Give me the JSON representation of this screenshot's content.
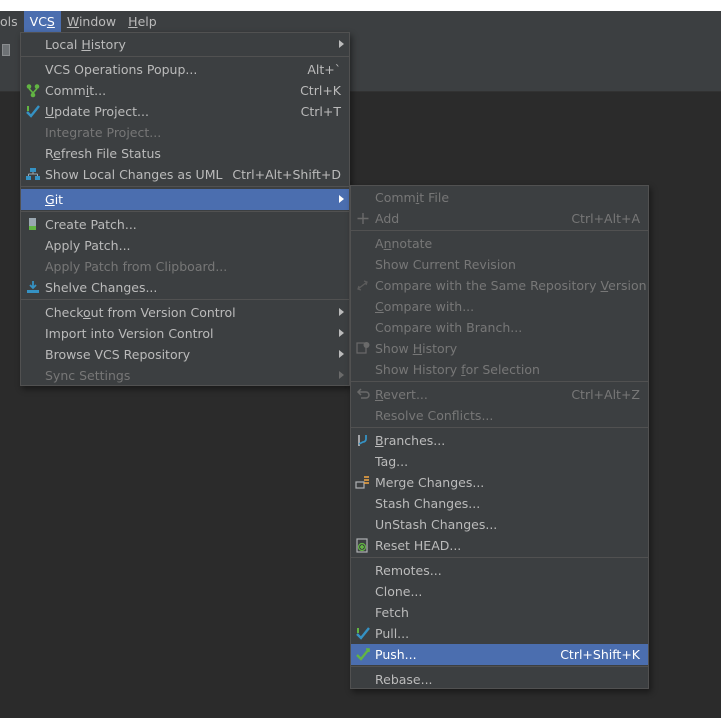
{
  "menubar": {
    "items": [
      {
        "label": "ols",
        "mnemonic": "",
        "after": ""
      },
      {
        "label": "VC",
        "mnemonic": "S",
        "after": ""
      },
      {
        "label": "",
        "mnemonic": "W",
        "after": "indow"
      },
      {
        "label": "",
        "mnemonic": "H",
        "after": "elp"
      }
    ]
  },
  "vcs_menu": {
    "local_history": {
      "pre": "Local ",
      "ac": "H",
      "post": "istory"
    },
    "operations_popup": {
      "label": "VCS Operations Popup...",
      "shortcut": "Alt+`"
    },
    "commit": {
      "pre": "Comm",
      "ac": "i",
      "post": "t...",
      "shortcut": "Ctrl+K"
    },
    "update_project": {
      "pre": "",
      "ac": "U",
      "post": "pdate Project...",
      "shortcut": "Ctrl+T"
    },
    "integrate_project": {
      "label": "Integrate Project..."
    },
    "refresh_status": {
      "pre": "R",
      "ac": "e",
      "post": "fresh File Status"
    },
    "show_local_changes": {
      "label": "Show Local Changes as UML",
      "shortcut": "Ctrl+Alt+Shift+D"
    },
    "git": {
      "pre": "",
      "ac": "G",
      "post": "it"
    },
    "create_patch": {
      "label": "Create Patch..."
    },
    "apply_patch": {
      "label": "Apply Patch..."
    },
    "apply_clipboard": {
      "label": "Apply Patch from Clipboard..."
    },
    "shelve_changes": {
      "label": "Shelve Changes..."
    },
    "checkout": {
      "pre": "Check",
      "ac": "o",
      "post": "ut from Version Control"
    },
    "import": {
      "label": "Import into Version Control"
    },
    "browse": {
      "label": "Browse VCS Repository"
    },
    "sync": {
      "label": "Sync Settings"
    }
  },
  "git_menu": {
    "commit_file": {
      "pre": "Comm",
      "ac": "i",
      "post": "t File"
    },
    "add": {
      "label": "Add",
      "shortcut": "Ctrl+Alt+A"
    },
    "annotate": {
      "pre": "A",
      "ac": "n",
      "post": "notate"
    },
    "show_current_revision": {
      "label": "Show Current Revision"
    },
    "compare_same": {
      "pre": "Compare with the Same Repository ",
      "ac": "V",
      "post": "ersion"
    },
    "compare_with": {
      "pre": "",
      "ac": "C",
      "post": "ompare with..."
    },
    "compare_branch": {
      "label": "Compare with Branch..."
    },
    "show_history": {
      "pre": "Show ",
      "ac": "H",
      "post": "istory"
    },
    "show_history_selection": {
      "pre": "Show History ",
      "ac": "f",
      "post": "or Selection"
    },
    "revert": {
      "pre": "",
      "ac": "R",
      "post": "evert...",
      "shortcut": "Ctrl+Alt+Z"
    },
    "resolve_conflicts": {
      "label": "Resolve Conflicts..."
    },
    "branches": {
      "pre": "",
      "ac": "B",
      "post": "ranches..."
    },
    "tag": {
      "label": "Tag..."
    },
    "merge_changes": {
      "label": "Merge Changes..."
    },
    "stash_changes": {
      "label": "Stash Changes..."
    },
    "unstash_changes": {
      "label": "UnStash Changes..."
    },
    "reset_head": {
      "label": "Reset HEAD..."
    },
    "remotes": {
      "label": "Remotes..."
    },
    "clone": {
      "label": "Clone..."
    },
    "fetch": {
      "label": "Fetch"
    },
    "pull": {
      "label": "Pull..."
    },
    "push": {
      "label": "Push...",
      "shortcut": "Ctrl+Shift+K"
    },
    "rebase": {
      "label": "Rebase..."
    }
  },
  "colors": {
    "menu_bg": "#3c3f41",
    "selection": "#4b6eaf",
    "text": "#bbbbbb",
    "disabled_text": "#777777",
    "editor_bg": "#2b2b2b"
  }
}
